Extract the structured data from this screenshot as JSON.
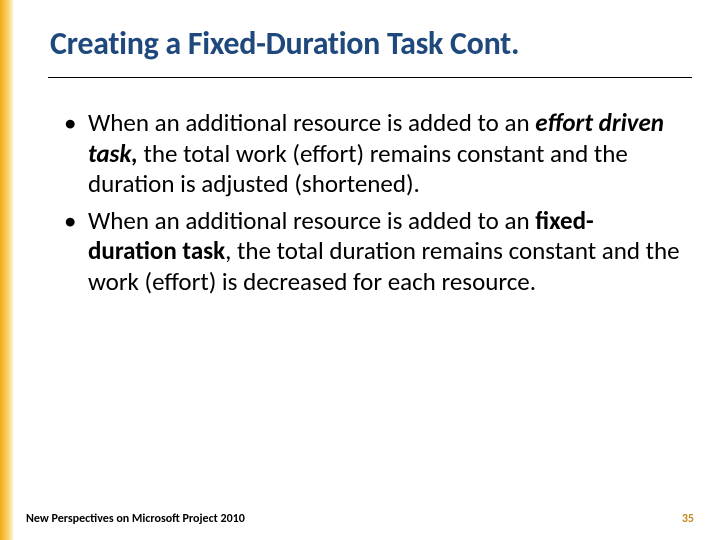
{
  "title": "Creating a Fixed-Duration Task Cont.",
  "bullets": [
    {
      "pre": "When an additional resource is added to an ",
      "em": "effort driven task,",
      "post": " the total work (effort) remains constant and the duration is adjusted (shortened)."
    },
    {
      "pre": "When an additional resource is added to an ",
      "em": "fixed-duration task",
      "post": ", the total duration remains constant and the work (effort) is decreased for each resource."
    }
  ],
  "footer": {
    "source": "New Perspectives on Microsoft Project 2010",
    "page": "35"
  }
}
